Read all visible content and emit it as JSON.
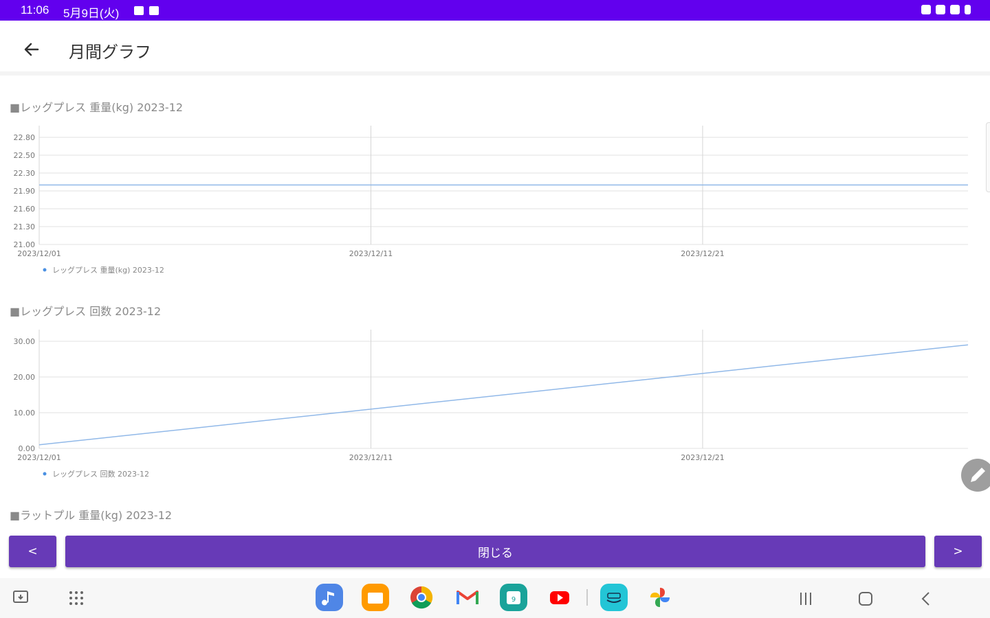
{
  "status_bar": {
    "time": "11:06",
    "date": "5月9日(火)",
    "background": "#6200ee"
  },
  "toolbar": {
    "title": "月間グラフ",
    "back_icon": "arrow-left-icon"
  },
  "charts": [
    {
      "title": "■レッグプレス 重量(kg) 2023-12",
      "legend": "レッグプレス 重量(kg) 2023-12",
      "y_ticks": [
        "22.80",
        "22.50",
        "22.30",
        "21.90",
        "21.60",
        "21.30",
        "21.00"
      ],
      "x_ticks": [
        "2023/12/01",
        "2023/12/11",
        "2023/12/21"
      ]
    },
    {
      "title": "■レッグプレス 回数 2023-12",
      "legend": "レッグプレス 回数 2023-12",
      "y_ticks": [
        "30.00",
        "20.00",
        "10.00",
        "0.00"
      ],
      "x_ticks": [
        "2023/12/01",
        "2023/12/11",
        "2023/12/21"
      ]
    },
    {
      "title": "■ラットプル 重量(kg) 2023-12"
    }
  ],
  "chart_data": [
    {
      "type": "line",
      "title": "レッグプレス 重量(kg) 2023-12",
      "x_range": [
        "2023/12/01",
        "2023/12/29"
      ],
      "ylim": [
        21.0,
        22.8
      ],
      "series": [
        {
          "name": "レッグプレス 重量(kg) 2023-12",
          "x": [
            "2023/12/01",
            "2023/12/29"
          ],
          "values": [
            22.0,
            22.0
          ],
          "color": "#90b8e8"
        }
      ],
      "grid": true,
      "legend": "bottom-left"
    },
    {
      "type": "line",
      "title": "レッグプレス 回数 2023-12",
      "x_range": [
        "2023/12/01",
        "2023/12/29"
      ],
      "ylim": [
        0,
        30
      ],
      "series": [
        {
          "name": "レッグプレス 回数 2023-12",
          "x": [
            "2023/12/01",
            "2023/12/29"
          ],
          "values": [
            1,
            29
          ],
          "color": "#90b8e8"
        }
      ],
      "grid": true,
      "legend": "bottom-left"
    }
  ],
  "buttons": {
    "prev": "<",
    "close": "閉じる",
    "next": ">",
    "color": "#673ab7"
  },
  "navbar": {
    "apps": [
      "music-icon",
      "folder-icon",
      "chrome-icon",
      "gmail-icon",
      "calendar-icon",
      "youtube-icon",
      "prime-video-icon",
      "photos-icon"
    ]
  }
}
